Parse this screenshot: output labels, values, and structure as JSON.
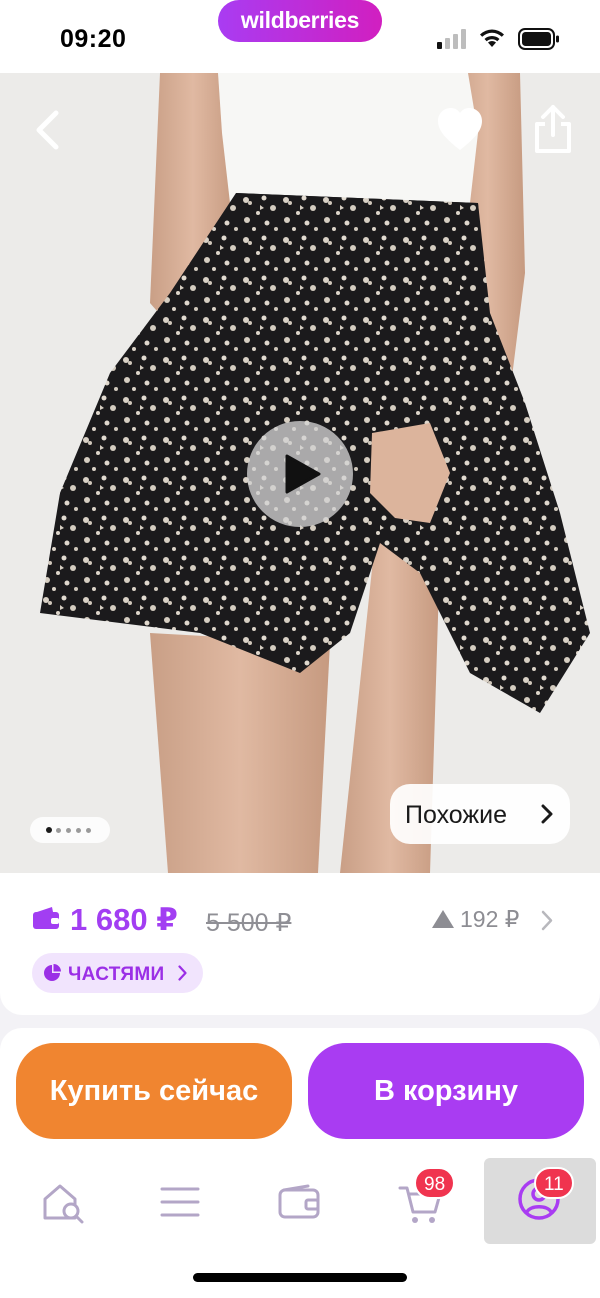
{
  "status_bar": {
    "time": "09:20",
    "brand": "wildberries"
  },
  "product": {
    "price": "1 680 ₽",
    "old_price": "5 500 ₽",
    "price_drop": "192 ₽",
    "installments_label": "ЧАСТЯМИ",
    "similar_label": "Похожие",
    "gallery": {
      "total": 5,
      "current": 1
    }
  },
  "actions": {
    "buy_now": "Купить сейчас",
    "add_to_cart": "В корзину"
  },
  "tabbar": {
    "items": [
      {
        "icon": "home-search-icon"
      },
      {
        "icon": "catalog-menu-icon"
      },
      {
        "icon": "wallet-icon"
      },
      {
        "icon": "cart-icon",
        "badge": "98"
      },
      {
        "icon": "profile-icon",
        "badge": "11",
        "active": true
      }
    ]
  },
  "colors": {
    "accent": "#a93cf2",
    "buy": "#f08530",
    "badge": "#f0344f"
  }
}
